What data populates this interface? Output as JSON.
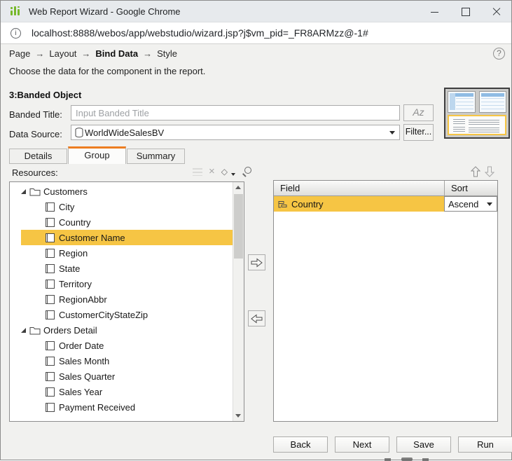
{
  "window": {
    "title": "Web Report Wizard - Google Chrome"
  },
  "urlbar": {
    "url": "localhost:8888/webos/app/webstudio/wizard.jsp?j$vm_pid=_FR8ARMzz@-1#"
  },
  "colors": {
    "highlight": "#F6C544",
    "tab_accent": "#ED7D20",
    "app_green": "#76B82A"
  },
  "wizard": {
    "steps": [
      "Page",
      "Layout",
      "Bind Data",
      "Style"
    ],
    "active_step": "Bind Data",
    "step_arrow": "→",
    "description": "Choose the data for the component in the report.",
    "section_title": "3:Banded Object",
    "banded_title": {
      "label": "Banded Title:",
      "placeholder": "Input Banded Title",
      "font_button": "Az"
    },
    "data_source": {
      "label": "Data Source:",
      "value": "WorldWideSalesBV",
      "filter_button": "Filter..."
    },
    "layout_thumbnails": [
      {
        "name": "table-with-row-header",
        "selected": false
      },
      {
        "name": "table",
        "selected": false
      },
      {
        "name": "banded-object",
        "selected": true
      }
    ],
    "tabs": [
      {
        "label": "Details",
        "active": false
      },
      {
        "label": "Group",
        "active": true
      },
      {
        "label": "Summary",
        "active": false
      }
    ],
    "resources_label": "Resources:",
    "resources_toolbar": [
      {
        "name": "modify-icon",
        "disabled": true
      },
      {
        "name": "delete-icon",
        "disabled": false
      },
      {
        "name": "swap-icon",
        "disabled": false
      },
      {
        "name": "search-icon",
        "disabled": false
      }
    ],
    "tree": [
      {
        "label": "Customers",
        "type": "folder",
        "expanded": true
      },
      {
        "label": "City",
        "type": "field"
      },
      {
        "label": "Country",
        "type": "field"
      },
      {
        "label": "Customer Name",
        "type": "field",
        "selected": true
      },
      {
        "label": "Region",
        "type": "field"
      },
      {
        "label": "State",
        "type": "field"
      },
      {
        "label": "Territory",
        "type": "field"
      },
      {
        "label": "RegionAbbr",
        "type": "field"
      },
      {
        "label": "CustomerCityStateZip",
        "type": "field"
      },
      {
        "label": "Orders Detail",
        "type": "folder",
        "expanded": true
      },
      {
        "label": "Order Date",
        "type": "field"
      },
      {
        "label": "Sales Month",
        "type": "field"
      },
      {
        "label": "Sales Quarter",
        "type": "field"
      },
      {
        "label": "Sales Year",
        "type": "field"
      },
      {
        "label": "Payment Received",
        "type": "field"
      }
    ],
    "group_table": {
      "columns": [
        "Field",
        "Sort"
      ],
      "rows": [
        {
          "field": "Country",
          "sort": "Ascend",
          "selected": true
        }
      ]
    },
    "footer_buttons": [
      "Back",
      "Next",
      "Save",
      "Run"
    ]
  }
}
